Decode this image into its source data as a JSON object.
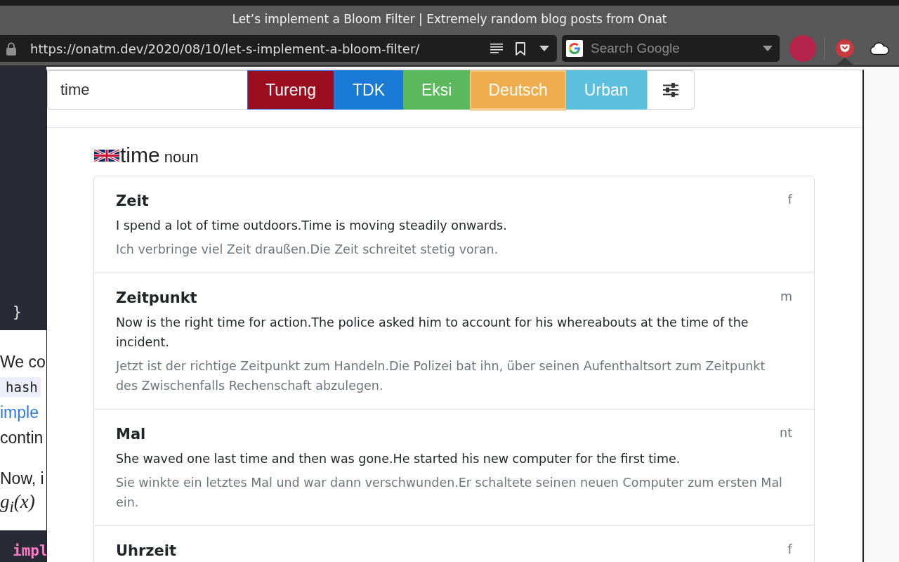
{
  "browser": {
    "title": "Let’s implement a Bloom Filter | Extremely random blog posts from Onat",
    "url": "https://onatm.dev/2020/08/10/let-s-implement-a-bloom-filter/",
    "search": {
      "placeholder": "Search Google"
    }
  },
  "page": {
    "code_top": "}",
    "paragraphs": [
      [
        {
          "kind": "text",
          "text": "We co"
        },
        {
          "kind": "code",
          "text": "hash"
        },
        {
          "kind": "link",
          "text": "imple"
        },
        {
          "kind": "text",
          "text": "contin"
        }
      ],
      [
        {
          "kind": "text",
          "text": "Now, i"
        },
        {
          "kind": "math",
          "text": "g$_{i}$(x)"
        }
      ]
    ],
    "code_bottom": "impl"
  },
  "popup": {
    "query": "time",
    "sources": [
      {
        "label": "Tureng",
        "color": "#9b0e1f",
        "selected": false,
        "focused": true
      },
      {
        "label": "TDK",
        "color": "#1a7bd6",
        "selected": false,
        "focused": false
      },
      {
        "label": "Eksi",
        "color": "#5cb85c",
        "selected": false,
        "focused": false
      },
      {
        "label": "Deutsch",
        "color": "#f0ad4e",
        "selected": true,
        "focused": false
      },
      {
        "label": "Urban",
        "color": "#5bc0de",
        "selected": false,
        "focused": false
      }
    ],
    "entry": {
      "word": "time",
      "part_of_speech": "noun",
      "translations": [
        {
          "word": "Zeit",
          "gender": "f",
          "example": "I spend a lot of time outdoors.Time is moving steadily onwards.",
          "example_translation": "Ich verbringe viel Zeit draußen.Die Zeit schreitet stetig voran."
        },
        {
          "word": "Zeitpunkt",
          "gender": "m",
          "example": "Now is the right time for action.The police asked him to account for his whereabouts at the time of the incident.",
          "example_translation": "Jetzt ist der richtige Zeitpunkt zum Handeln.Die Polizei bat ihn, über seinen Aufenthaltsort zum Zeitpunkt des Zwischenfalls Rechenschaft abzulegen."
        },
        {
          "word": "Mal",
          "gender": "nt",
          "example": "She waved one last time and then was gone.He started his new computer for the first time.",
          "example_translation": "Sie winkte ein letztes Mal und war dann verschwunden.Er schaltete seinen neuen Computer zum ersten Mal ein."
        },
        {
          "word": "Uhrzeit",
          "gender": "f"
        }
      ]
    }
  }
}
